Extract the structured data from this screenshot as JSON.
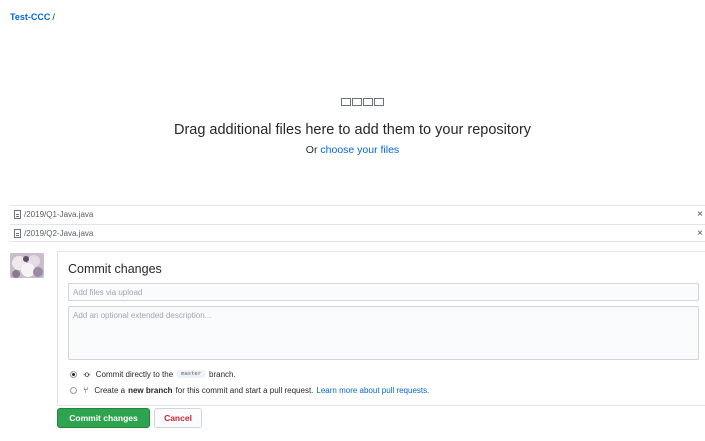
{
  "breadcrumb": {
    "repo": "Test-CCC",
    "separator": "/"
  },
  "dropzone": {
    "title": "Drag additional files here to add them to your repository",
    "sub_prefix": "Or",
    "sub_link": "choose your files"
  },
  "files": [
    {
      "name": "/2019/Q1-Java.java",
      "remove": "×"
    },
    {
      "name": "/2019/Q2-Java.java",
      "remove": "×"
    }
  ],
  "commit": {
    "title": "Commit changes",
    "summary_placeholder": "Add files via upload",
    "description_placeholder": "Add an optional extended description...",
    "option_direct": {
      "prefix": "Commit directly to the",
      "branch": "master",
      "suffix": "branch.",
      "icon": "git-commit-icon"
    },
    "option_new": {
      "prefix": "Create a",
      "bold": "new branch",
      "suffix": "for this commit and start a pull request.",
      "link": "Learn more about pull requests.",
      "icon": "git-pull-request-icon"
    },
    "submit_label": "Commit changes",
    "cancel_label": "Cancel"
  },
  "colors": {
    "link": "#0366d6",
    "commit_button": "#2ea44f",
    "cancel_text": "#cb2431"
  }
}
